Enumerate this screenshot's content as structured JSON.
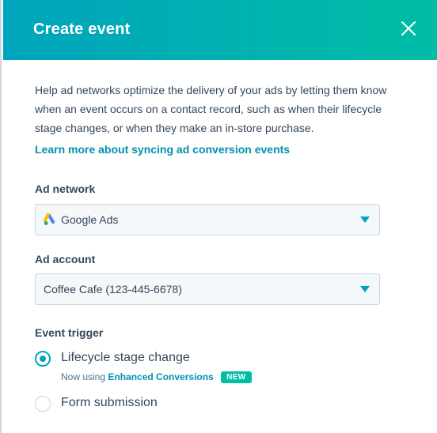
{
  "header": {
    "title": "Create event",
    "close_icon": "close-icon"
  },
  "description": "Help ad networks optimize the delivery of your ads by letting them know when an event occurs on a contact record, such as when their lifecycle stage changes,  or when they make an in-store purchase.",
  "learn_more_link": "Learn more about syncing ad conversion events",
  "ad_network": {
    "label": "Ad network",
    "value": "Google Ads",
    "icon": "google-ads-icon"
  },
  "ad_account": {
    "label": "Ad account",
    "value": "Coffee Cafe (123-445-6678)"
  },
  "event_trigger": {
    "label": "Event trigger",
    "options": [
      {
        "label": "Lifecycle stage change",
        "selected": true
      },
      {
        "label": "Form submission",
        "selected": false
      }
    ],
    "sub_prefix": "Now using",
    "sub_link": "Enhanced Conversions",
    "badge": "NEW"
  },
  "colors": {
    "header_start": "#00a4bd",
    "header_end": "#00bda5",
    "link": "#0091ae",
    "badge": "#00bda5",
    "text": "#33475b"
  }
}
